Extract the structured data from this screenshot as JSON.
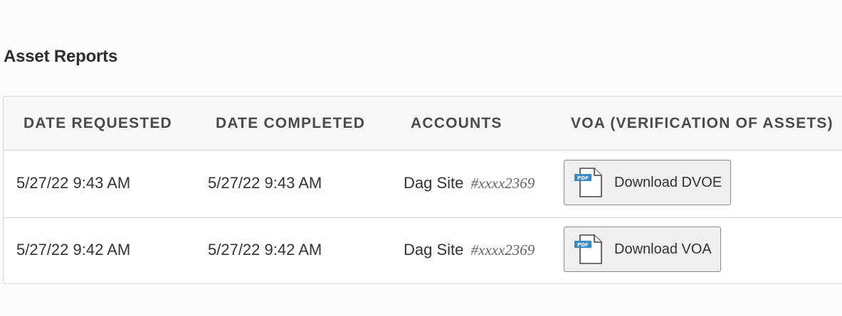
{
  "section_title": "Asset Reports",
  "table": {
    "headers": {
      "date_requested": "DATE REQUESTED",
      "date_completed": "DATE COMPLETED",
      "accounts": "ACCOUNTS",
      "voa": "VOA (VERIFICATION OF ASSETS)"
    },
    "rows": [
      {
        "date_requested": "5/27/22 9:43 AM",
        "date_completed": "5/27/22 9:43 AM",
        "account_name": "Dag Site",
        "account_mask": "#xxxx2369",
        "button_label": "Download DVOE",
        "icon_text": "PDF"
      },
      {
        "date_requested": "5/27/22 9:42 AM",
        "date_completed": "5/27/22 9:42 AM",
        "account_name": "Dag Site",
        "account_mask": "#xxxx2369",
        "button_label": "Download VOA",
        "icon_text": "PDF"
      }
    ]
  },
  "icons": {
    "download_button_icon": "pdf-file-icon"
  },
  "colors": {
    "pdf_badge": "#3a8cc8",
    "button_bg": "#efefef",
    "header_bg": "#f7f8fa"
  }
}
